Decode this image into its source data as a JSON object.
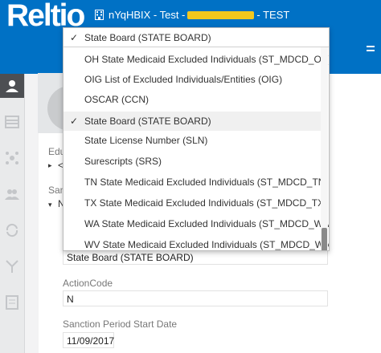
{
  "app": {
    "logo": "Reltio"
  },
  "header": {
    "tenant_prefix": "nYqHBIX - Test -",
    "tenant_suffix": "- TEST"
  },
  "form": {
    "education_label": "Edu",
    "education_value": "<",
    "sanctions_label": "San",
    "sanctions_sub": "N",
    "sanction_source_value": "State Board (STATE BOARD)",
    "action_code_label": "ActionCode",
    "action_code_value": "N",
    "start_date_label": "Sanction Period Start Date",
    "start_date_value": "11/09/2017"
  },
  "dropdown": {
    "selected": "State Board (STATE BOARD)",
    "options": [
      "OH State Medicaid Excluded Individuals (ST_MDCD_OH)",
      "OIG List of Excluded Individuals/Entities (OIG)",
      "OSCAR (CCN)",
      "State Board (STATE BOARD)",
      "State License Number (SLN)",
      "Surescripts (SRS)",
      "TN State Medicaid Excluded Individuals (ST_MDCD_TN)",
      "TX State Medicaid Excluded Individuals (ST_MDCD_TX)",
      "WA State Medicaid Excluded Individuals (ST_MDCD_WA)",
      "WV State Medicaid Excluded Individuals (ST_MDCD_WV)"
    ],
    "checkmark": "✓"
  },
  "colors": {
    "header": "#0071c5",
    "sidebar_active": "#4d4f53"
  }
}
